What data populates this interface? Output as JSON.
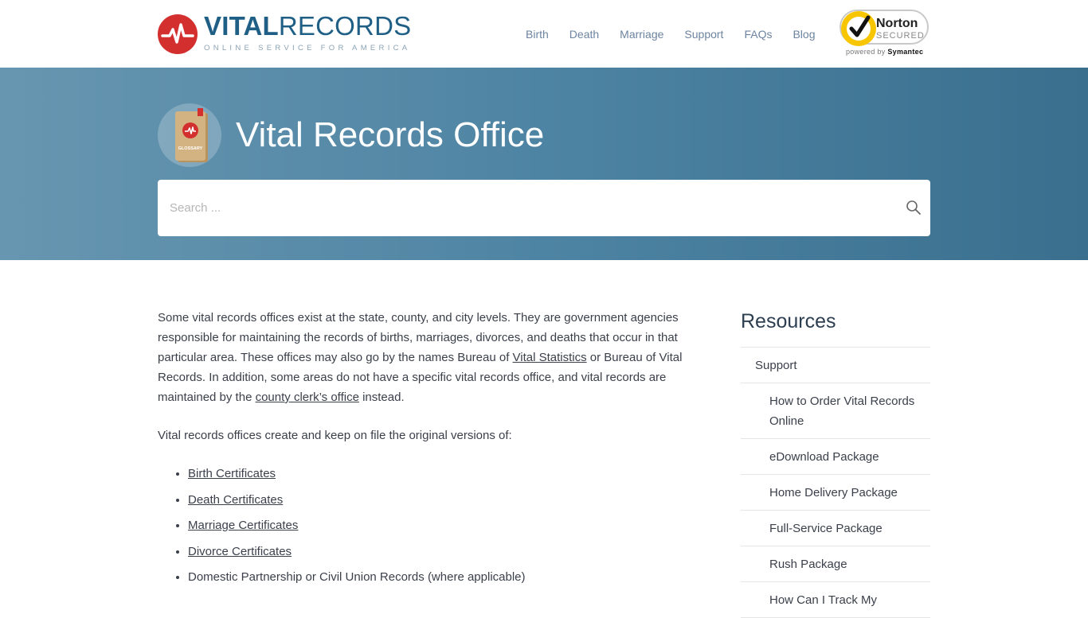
{
  "header": {
    "logo_bold": "VITAL",
    "logo_light": "RECORDS",
    "logo_tagline": "ONLINE SERVICE FOR AMERICA",
    "nav": [
      "Birth",
      "Death",
      "Marriage",
      "Support",
      "FAQs",
      "Blog"
    ],
    "norton": {
      "name": "Norton",
      "secured": "SECURED",
      "powered": "powered by",
      "brand": "Symantec"
    }
  },
  "hero": {
    "icon_label": "GLOSSARY",
    "title": "Vital Records Office",
    "search_placeholder": "Search ..."
  },
  "main": {
    "p1_a": "Some vital records offices exist at the state, county, and city levels. They are government agencies responsible for maintaining the records of births, marriages, divorces, and deaths that occur in that particular area. These offices may also go by the names Bureau of ",
    "p1_link1": "Vital Statistics",
    "p1_b": " or Bureau of Vital Records. In addition, some areas do not have a specific vital records office, and vital records are maintained by the ",
    "p1_link2": "county clerk’s office",
    "p1_c": " instead.",
    "p2": "Vital records offices create and keep on file the original versions of:",
    "list": [
      {
        "text": "Birth Certificates",
        "link": true
      },
      {
        "text": "Death Certificates",
        "link": true
      },
      {
        "text": "Marriage Certificates",
        "link": true
      },
      {
        "text": "Divorce Certificates",
        "link": true
      },
      {
        "text": "Domestic Partnership or Civil Union Records (where applicable)",
        "link": false
      }
    ]
  },
  "sidebar": {
    "title": "Resources",
    "items": [
      {
        "label": "Support",
        "level": 1
      },
      {
        "label": "How to Order Vital Records Online",
        "level": 2
      },
      {
        "label": "eDownload Package",
        "level": 2
      },
      {
        "label": "Home Delivery Package",
        "level": 2
      },
      {
        "label": "Full-Service Package",
        "level": 2
      },
      {
        "label": "Rush Package",
        "level": 2
      },
      {
        "label": "How Can I Track My",
        "level": 2
      }
    ]
  },
  "colors": {
    "brand_blue": "#1f5f86",
    "brand_red": "#d32f2f",
    "hero_start": "#6796b0",
    "hero_end": "#3a6f8e"
  }
}
